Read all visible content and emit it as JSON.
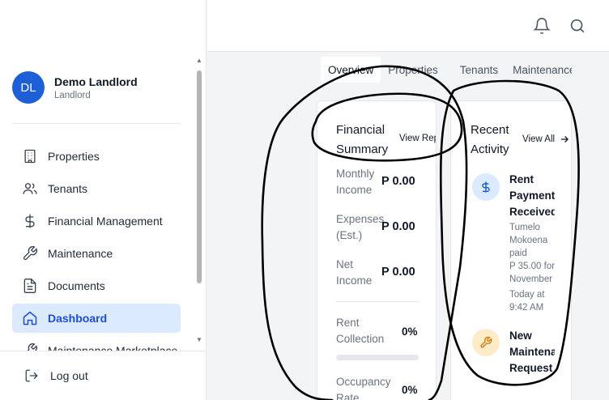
{
  "user": {
    "initials": "DL",
    "name": "Demo Landlord",
    "role": "Landlord"
  },
  "nav": [
    {
      "label": "Properties",
      "icon": "building-icon"
    },
    {
      "label": "Tenants",
      "icon": "users-icon"
    },
    {
      "label": "Financial Management",
      "icon": "dollar-icon"
    },
    {
      "label": "Maintenance",
      "icon": "wrench-icon"
    },
    {
      "label": "Documents",
      "icon": "document-icon"
    },
    {
      "label": "Dashboard",
      "icon": "home-icon",
      "active": true
    },
    {
      "label": "Maintenance Marketplace",
      "icon": "marketplace-icon"
    }
  ],
  "logout_label": "Log out",
  "tabs": [
    "Overview",
    "Properties",
    "Tenants",
    "Maintenance"
  ],
  "financial": {
    "title_line1": "Financial",
    "title_line2": "Summary",
    "link": "View Report",
    "monthly_income_l1": "Monthly",
    "monthly_income_l2": "Income",
    "monthly_income_value": "P 0.00",
    "expenses_l1": "Expenses",
    "expenses_l2": "(Est.)",
    "expenses_value": "P 0.00",
    "net_income_l1": "Net",
    "net_income_l2": "Income",
    "net_income_value": "P 0.00",
    "rent_collection_l1": "Rent",
    "rent_collection_l2": "Collection",
    "rent_collection_value": "0%",
    "rent_collection_progress": 0,
    "occupancy_l1": "Occupancy",
    "occupancy_l2": "Rate",
    "occupancy_value": "0%"
  },
  "activity": {
    "title_line1": "Recent",
    "title_line2": "Activity",
    "link": "View All",
    "items": [
      {
        "icon": "dollar-icon",
        "title": [
          "Rent",
          "Payment",
          "Received"
        ],
        "desc": [
          "Tumelo",
          "Mokoena",
          "paid",
          "P 35.00 for",
          "November",
          "Today at",
          "9:42 AM"
        ]
      },
      {
        "icon": "wrench-icon",
        "title": [
          "New",
          "Maintenance",
          "Request"
        ]
      }
    ]
  },
  "colors": {
    "accent": "#1d5fd6",
    "active_bg": "#dbeafe",
    "payment_icon_bg": "#dbeafe",
    "maintenance_icon_bg": "#fdecc8"
  }
}
